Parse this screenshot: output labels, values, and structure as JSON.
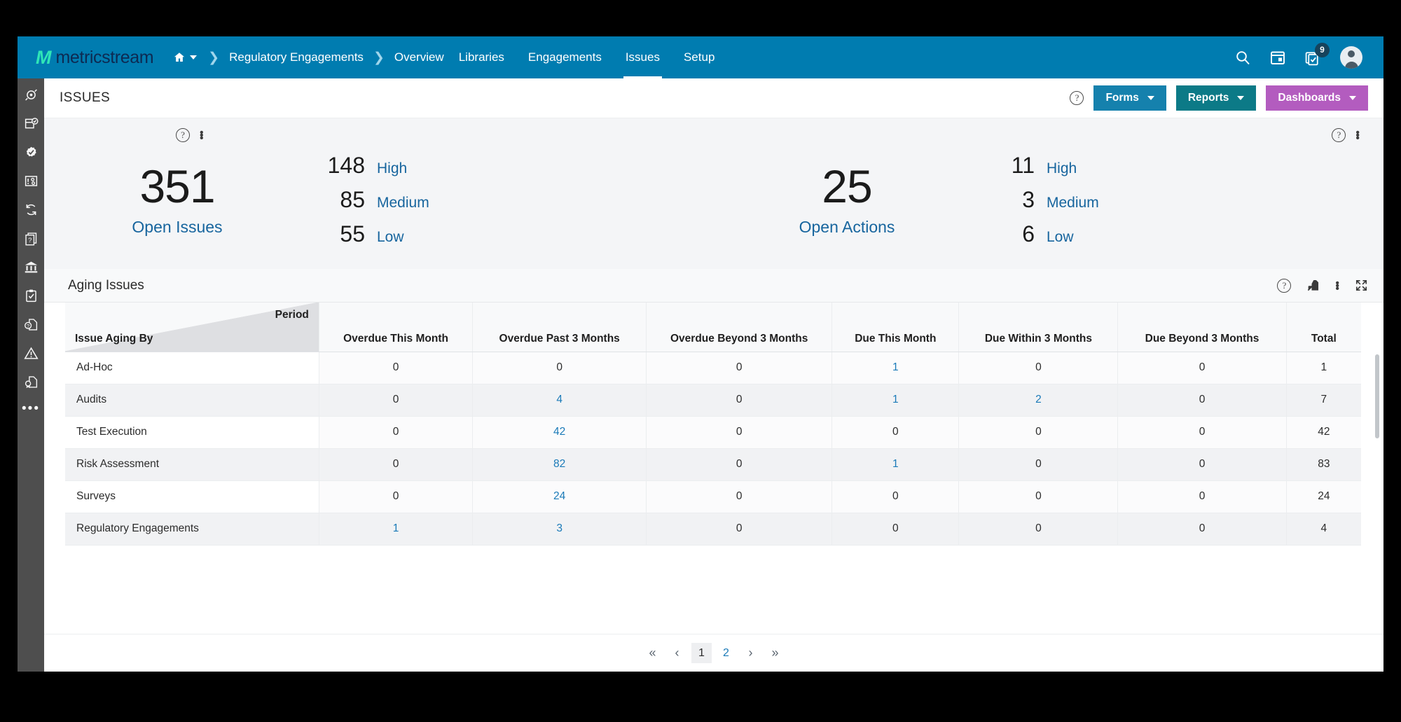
{
  "topnav": {
    "brand_mark": "M",
    "brand_text": "metricstream",
    "home_icon": "home-icon",
    "breadcrumb": [
      "Regulatory Engagements",
      "Overview"
    ],
    "links": [
      "Libraries",
      "Engagements",
      "Issues",
      "Setup"
    ],
    "active_link": "Issues",
    "icons": [
      "search-icon",
      "calendar-icon",
      "tasks-icon",
      "user-avatar-icon"
    ],
    "task_badge": "9"
  },
  "rail": {
    "items": [
      "risk-target-icon",
      "policy-check-icon",
      "compliance-gear-icon",
      "issue-settings-icon",
      "refresh-cycle-icon",
      "question-docs-icon",
      "bank-icon",
      "clipboard-check-icon",
      "help-document-icon",
      "warning-triangle-icon",
      "certificate-document-icon"
    ],
    "more": "•••"
  },
  "pageheader": {
    "title": "ISSUES",
    "help_icon": "help-circle-icon",
    "buttons": [
      {
        "label": "Forms",
        "name": "forms-button",
        "color": "#1581ad"
      },
      {
        "label": "Reports",
        "name": "reports-button",
        "color": "#0c7a87"
      },
      {
        "label": "Dashboards",
        "name": "dashboards-button",
        "color": "#b35cbf"
      }
    ]
  },
  "kpis": [
    {
      "name": "open-issues-widget",
      "value": "351",
      "label": "Open Issues",
      "breakdown": [
        {
          "value": "148",
          "label": "High"
        },
        {
          "value": "85",
          "label": "Medium"
        },
        {
          "value": "55",
          "label": "Low"
        }
      ]
    },
    {
      "name": "open-actions-widget",
      "value": "25",
      "label": "Open Actions",
      "breakdown": [
        {
          "value": "11",
          "label": "High"
        },
        {
          "value": "3",
          "label": "Medium"
        },
        {
          "value": "6",
          "label": "Low"
        }
      ]
    }
  ],
  "card": {
    "title": "Aging Issues",
    "tools": [
      "help-circle-icon",
      "export-icon",
      "kebab-menu-icon",
      "fullscreen-icon"
    ]
  },
  "table": {
    "corner": {
      "top_right": "Period",
      "bottom_left": "Issue Aging By"
    },
    "columns": [
      "Overdue This Month",
      "Overdue Past 3 Months",
      "Overdue Beyond 3 Months",
      "Due This Month",
      "Due Within 3 Months",
      "Due Beyond 3 Months",
      "Total"
    ],
    "rows": [
      {
        "label": "Ad-Hoc",
        "cells": [
          "0",
          "0",
          "0",
          "1",
          "0",
          "0",
          "1"
        ],
        "links": [
          false,
          false,
          false,
          true,
          false,
          false,
          false
        ]
      },
      {
        "label": "Audits",
        "cells": [
          "0",
          "4",
          "0",
          "1",
          "2",
          "0",
          "7"
        ],
        "links": [
          false,
          true,
          false,
          true,
          true,
          false,
          false
        ]
      },
      {
        "label": "Test Execution",
        "cells": [
          "0",
          "42",
          "0",
          "0",
          "0",
          "0",
          "42"
        ],
        "links": [
          false,
          true,
          false,
          false,
          false,
          false,
          false
        ]
      },
      {
        "label": "Risk Assessment",
        "cells": [
          "0",
          "82",
          "0",
          "1",
          "0",
          "0",
          "83"
        ],
        "links": [
          false,
          true,
          false,
          true,
          false,
          false,
          false
        ]
      },
      {
        "label": "Surveys",
        "cells": [
          "0",
          "24",
          "0",
          "0",
          "0",
          "0",
          "24"
        ],
        "links": [
          false,
          true,
          false,
          false,
          false,
          false,
          false
        ]
      },
      {
        "label": "Regulatory Engagements",
        "cells": [
          "1",
          "3",
          "0",
          "0",
          "0",
          "0",
          "4"
        ],
        "links": [
          true,
          true,
          false,
          false,
          false,
          false,
          false
        ]
      }
    ]
  },
  "pagination": {
    "first": "«",
    "prev": "‹",
    "pages": [
      "1",
      "2"
    ],
    "current": "1",
    "next": "›",
    "last": "»"
  }
}
